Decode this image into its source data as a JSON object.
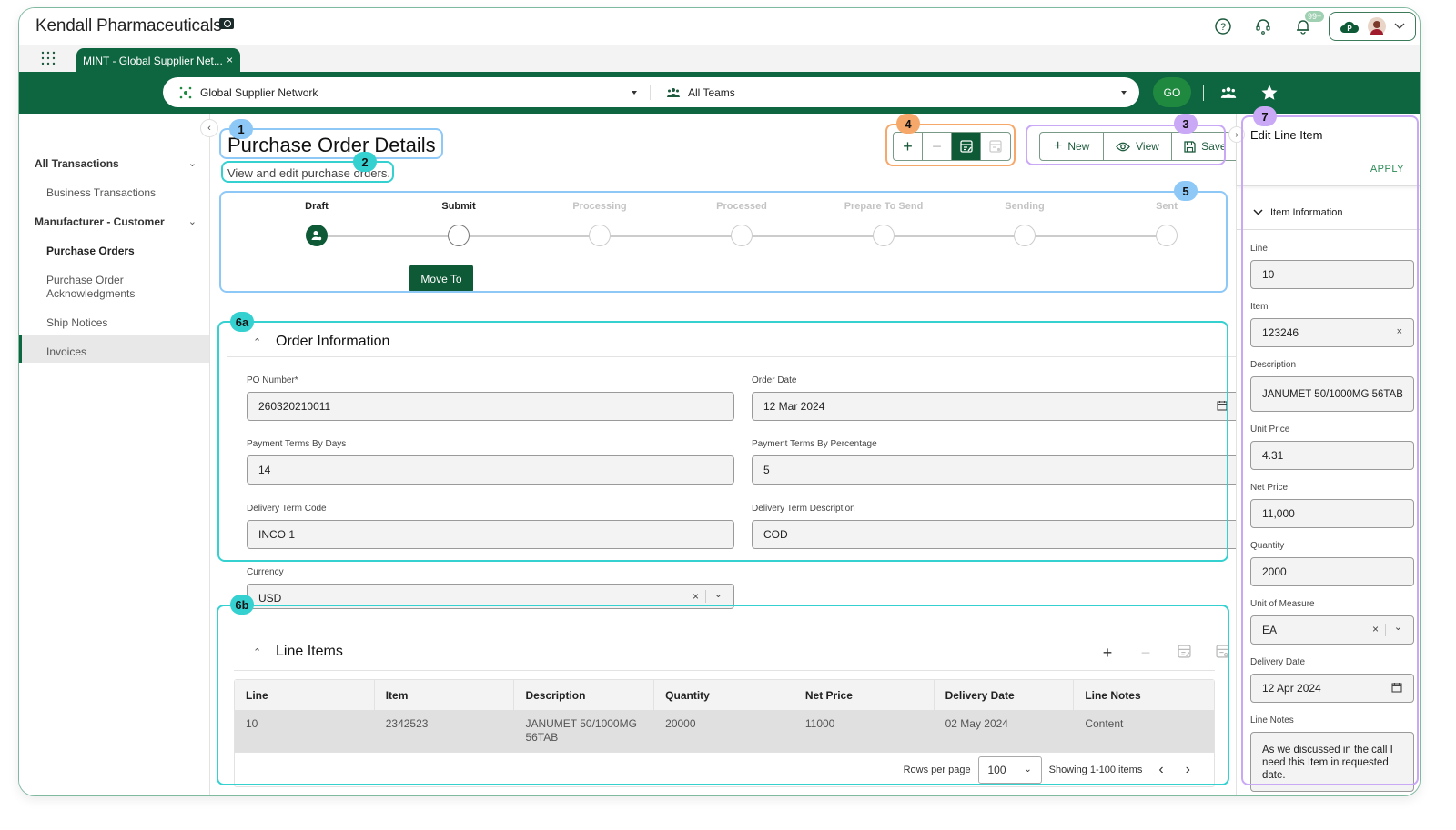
{
  "app": {
    "brand": "Kendall Pharmaceuticals",
    "notification_badge": "99+",
    "profile_initial": "P"
  },
  "tabs": [
    {
      "label": "MINT - Global Supplier Net...",
      "close": "×"
    }
  ],
  "filterbar": {
    "network": "Global Supplier Network",
    "teams": "All Teams",
    "go_label": "GO"
  },
  "sidebar": {
    "groups": [
      {
        "label": "All Transactions",
        "items": [
          "Business Transactions"
        ]
      },
      {
        "label": "Manufacturer - Customer",
        "items": [
          "Purchase Orders",
          "Purchase Order Acknowledgments",
          "Ship Notices",
          "Invoices"
        ]
      }
    ],
    "active": "Purchase Orders"
  },
  "page": {
    "title": "Purchase Order Details",
    "subtitle": "View and edit purchase orders."
  },
  "toolbar": {
    "new_label": "New",
    "view_label": "View",
    "save_label": "Save"
  },
  "stepper": {
    "steps": [
      "Draft",
      "Submit",
      "Processing",
      "Processed",
      "Prepare To Send",
      "Sending",
      "Sent"
    ],
    "current_index": 0,
    "move_label": "Move To"
  },
  "order_info": {
    "title": "Order Information",
    "fields": {
      "po_number": {
        "label": "PO Number*",
        "value": "260320210011"
      },
      "order_date": {
        "label": "Order Date",
        "value": "12 Mar 2024"
      },
      "payment_days": {
        "label": "Payment Terms By Days",
        "value": "14"
      },
      "payment_pct": {
        "label": "Payment Terms By Percentage",
        "value": "5"
      },
      "delivery_code": {
        "label": "Delivery Term Code",
        "value": "INCO 1"
      },
      "delivery_desc": {
        "label": "Delivery Term Description",
        "value": "COD"
      },
      "currency": {
        "label": "Currency",
        "value": "USD"
      }
    }
  },
  "line_items": {
    "title": "Line Items",
    "columns": [
      "Line",
      "Item",
      "Description",
      "Quantity",
      "Net Price",
      "Delivery Date",
      "Line Notes"
    ],
    "rows": [
      [
        "10",
        "2342523",
        "JANUMET 50/1000MG 56TAB",
        "20000",
        "11000",
        "02 May 2024",
        "Content"
      ]
    ],
    "rows_per_page_label": "Rows per page",
    "rows_per_page": "100",
    "showing": "Showing 1-100 items"
  },
  "edit_panel": {
    "title": "Edit Line Item",
    "apply": "APPLY",
    "section": "Item Information",
    "fields": {
      "line": {
        "label": "Line",
        "value": "10"
      },
      "item": {
        "label": "Item",
        "value": "123246"
      },
      "description": {
        "label": "Description",
        "value": "JANUMET 50/1000MG 56TAB"
      },
      "unit_price": {
        "label": "Unit Price",
        "value": "4.31"
      },
      "net_price": {
        "label": "Net Price",
        "value": "11,000"
      },
      "quantity": {
        "label": "Quantity",
        "value": "2000"
      },
      "uom": {
        "label": "Unit of Measure",
        "value": "EA"
      },
      "delivery_date": {
        "label": "Delivery Date",
        "value": "12 Apr 2024"
      },
      "line_notes": {
        "label": "Line Notes",
        "value": "As we discussed in the call I need this Item in requested date."
      }
    }
  },
  "annotations": {
    "a1": "1",
    "a2": "2",
    "a3": "3",
    "a4": "4",
    "a5": "5",
    "a6a": "6a",
    "a6b": "6b",
    "a7": "7"
  },
  "colors": {
    "brand_green": "#0e6640",
    "go_green": "#1f8a3f",
    "ann_blue": "#8ec8f7",
    "ann_teal": "#35d1d1",
    "ann_orange": "#f6a86b",
    "ann_purple": "#c9a8f5"
  }
}
